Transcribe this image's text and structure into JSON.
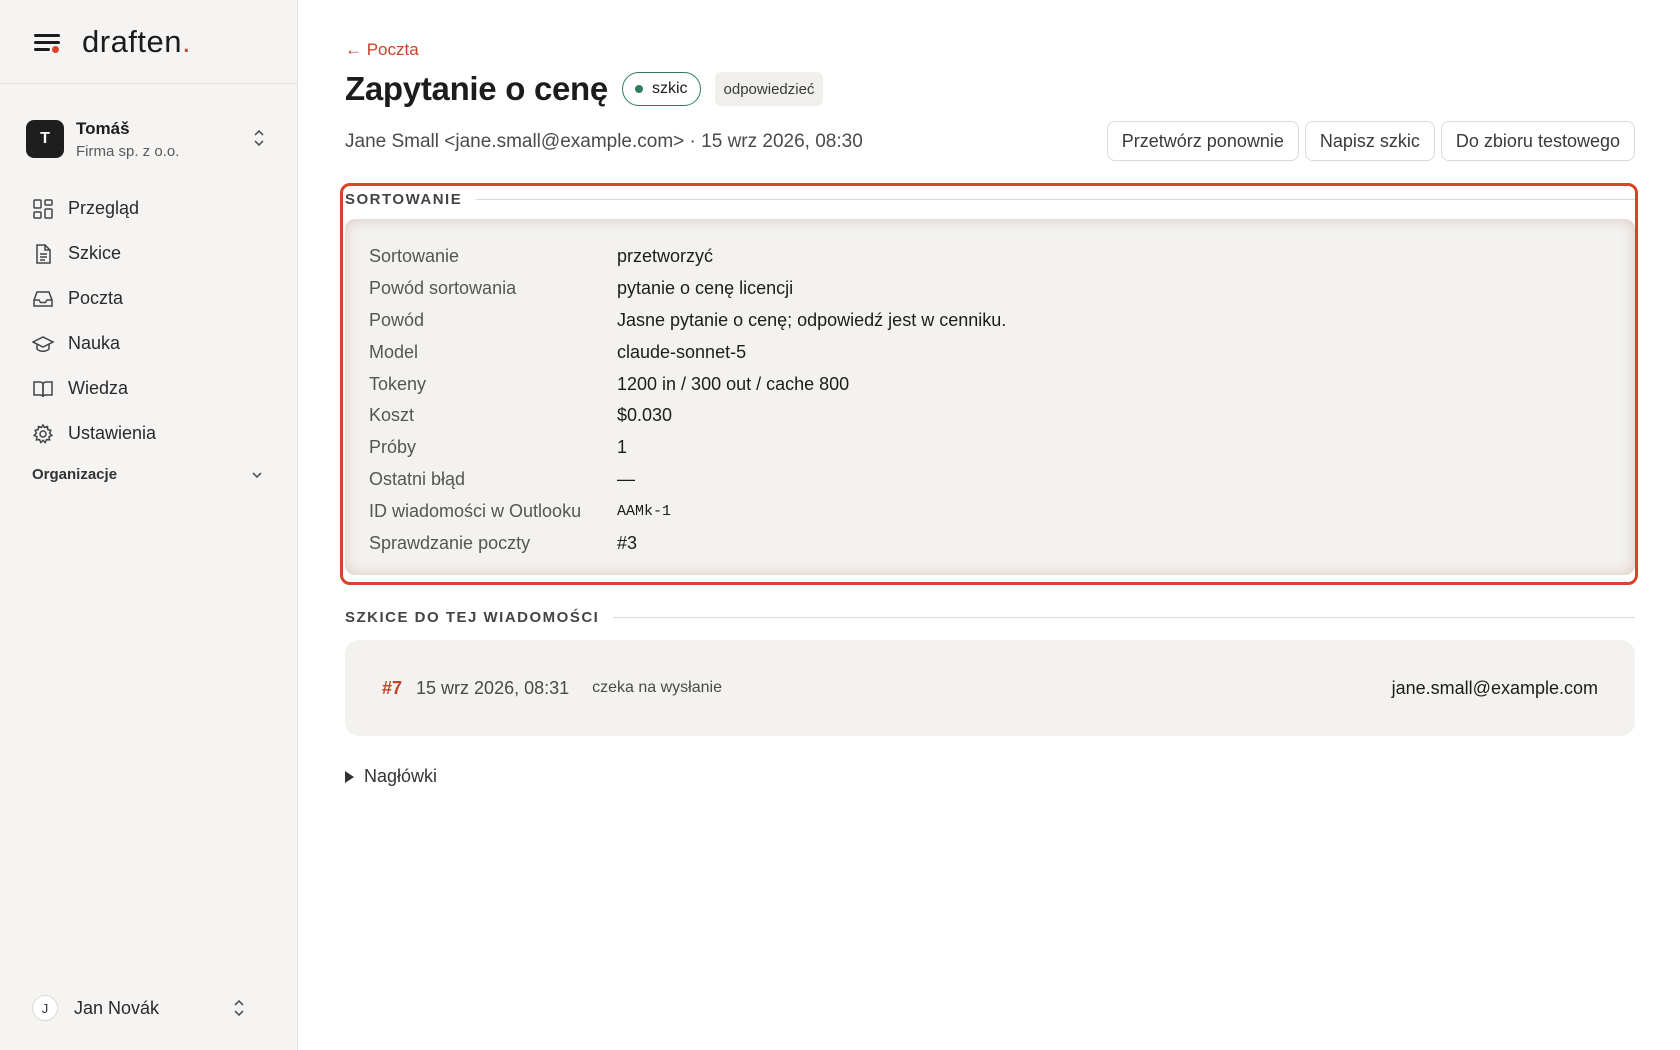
{
  "app": {
    "brand": "draften",
    "brand_dot": "."
  },
  "org": {
    "avatar_initial": "T",
    "name": "Tomáš",
    "company": "Firma sp. z o.o."
  },
  "nav": [
    {
      "label": "Przegląd",
      "icon": "dashboard-icon"
    },
    {
      "label": "Szkice",
      "icon": "document-icon"
    },
    {
      "label": "Poczta",
      "icon": "inbox-icon"
    },
    {
      "label": "Nauka",
      "icon": "graduation-cap-icon"
    },
    {
      "label": "Wiedza",
      "icon": "book-icon"
    },
    {
      "label": "Ustawienia",
      "icon": "gear-icon"
    }
  ],
  "sidebar_section": {
    "label": "Organizacje"
  },
  "user": {
    "initial": "J",
    "name": "Jan Novák"
  },
  "header": {
    "back_label": "← Poczta",
    "title": "Zapytanie o cenę",
    "status_badge": "szkic",
    "tag_badge": "odpowiedzieć",
    "meta": "Jane Small <jane.small@example.com> · 15 wrz 2026, 08:30"
  },
  "actions": {
    "reprocess": "Przetwórz ponownie",
    "write_draft": "Napisz szkic",
    "to_test_set": "Do zbioru testowego"
  },
  "sorting": {
    "section_title": "SORTOWANIE",
    "rows": [
      {
        "key": "Sortowanie",
        "value": "przetworzyć"
      },
      {
        "key": "Powód sortowania",
        "value": "pytanie o cenę licencji"
      },
      {
        "key": "Powód",
        "value": "Jasne pytanie o cenę; odpowiedź jest w cenniku."
      },
      {
        "key": "Model",
        "value": "claude-sonnet-5"
      },
      {
        "key": "Tokeny",
        "value": "1200 in / 300 out / cache 800"
      },
      {
        "key": "Koszt",
        "value": "$0.030"
      },
      {
        "key": "Próby",
        "value": "1"
      },
      {
        "key": "Ostatni błąd",
        "value": "—"
      },
      {
        "key": "ID wiadomości w Outlooku",
        "value": "AAMk-1"
      },
      {
        "key": "Sprawdzanie poczty",
        "value": "#3"
      }
    ]
  },
  "drafts": {
    "section_title": "SZKICE DO TEJ WIADOMOŚCI",
    "items": [
      {
        "id": "#7",
        "date": "15 wrz 2026, 08:31",
        "status": "czeka na wysłanie",
        "to": "jane.small@example.com"
      }
    ]
  },
  "headers_toggle": {
    "label": "Nagłówki"
  },
  "colors": {
    "accent": "#d9432b",
    "status_green": "#2f7d5a",
    "sidebar_bg": "#f5f4f2",
    "card_bg": "#f3f2ef"
  }
}
